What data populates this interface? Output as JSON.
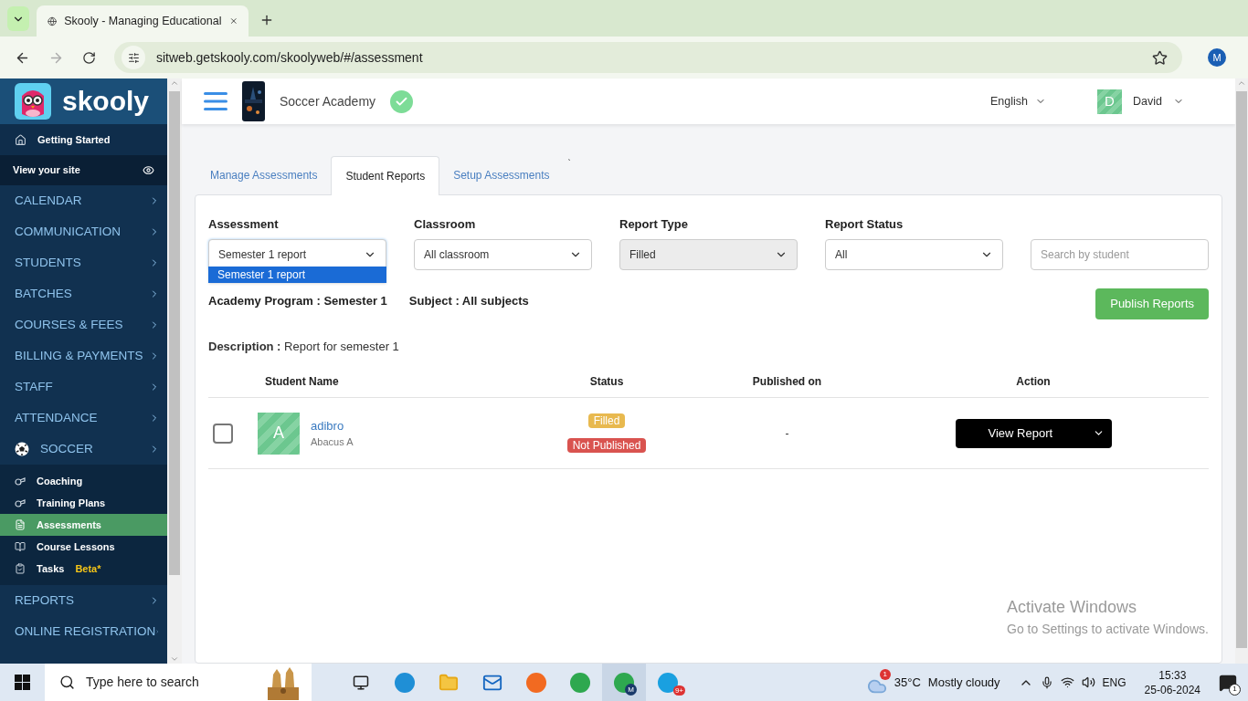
{
  "browser": {
    "tab_title": "Skooly - Managing Educational",
    "url": "sitweb.getskooly.com/skoolyweb/#/assessment",
    "profile_initial": "M"
  },
  "sidebar": {
    "logo_text": "skooly",
    "getting_started": "Getting Started",
    "view_site": "View your site",
    "menu": [
      {
        "label": "CALENDAR",
        "kind": "section"
      },
      {
        "label": "COMMUNICATION",
        "kind": "section"
      },
      {
        "label": "STUDENTS",
        "kind": "section"
      },
      {
        "label": "BATCHES",
        "kind": "section"
      },
      {
        "label": "COURSES & FEES",
        "kind": "section"
      },
      {
        "label": "BILLING & PAYMENTS",
        "kind": "section"
      },
      {
        "label": "STAFF",
        "kind": "section"
      },
      {
        "label": "ATTENDANCE",
        "kind": "section"
      },
      {
        "label": "SOCCER",
        "kind": "soccer",
        "children": [
          {
            "label": "Coaching",
            "kind": "whistle",
            "selected": false
          },
          {
            "label": "Training Plans",
            "kind": "whistle",
            "selected": false
          },
          {
            "label": "Assessments",
            "kind": "doc",
            "selected": true
          },
          {
            "label": "Course Lessons",
            "kind": "book",
            "selected": false
          },
          {
            "label": "Tasks",
            "kind": "clipboard",
            "selected": false,
            "badge": "Beta*"
          }
        ]
      },
      {
        "label": "REPORTS",
        "kind": "section"
      },
      {
        "label": "ONLINE REGISTRATION",
        "kind": "section"
      }
    ]
  },
  "header": {
    "school": "Soccer Academy",
    "language": "English",
    "user": {
      "initial": "D",
      "name": "David"
    }
  },
  "tabs": [
    {
      "label": "Manage Assessments",
      "selected": false
    },
    {
      "label": "Student Reports",
      "selected": true
    },
    {
      "label": "Setup Assessments",
      "selected": false
    }
  ],
  "stray_mark": "`",
  "filters": [
    {
      "label": "Assessment",
      "value": "Semester 1 report",
      "disabled": false,
      "open": true,
      "options": [
        {
          "label": "Semester 1 report",
          "selected": true
        }
      ]
    },
    {
      "label": "Classroom",
      "value": "All classroom",
      "disabled": false,
      "open": false
    },
    {
      "label": "Report Type",
      "value": "Filled",
      "disabled": true,
      "open": false
    },
    {
      "label": "Report Status",
      "value": "All",
      "disabled": false,
      "open": false
    }
  ],
  "search": {
    "placeholder": "Search by student"
  },
  "program": "Academy Program : Semester 1",
  "subject": "Subject : All subjects",
  "publish_button": "Publish Reports",
  "description": "**Description :** Report for semester 1",
  "table": {
    "columns": [
      "Student Name",
      "Status",
      "Published on",
      "Action"
    ],
    "rows": [
      {
        "checked": false,
        "avatar": "A",
        "name": "adibro",
        "class": "Abacus A",
        "statuses": [
          {
            "label": "Filled",
            "color": "#e8b94f"
          },
          {
            "label": "Not Published",
            "color": "#d9534f"
          }
        ],
        "published_on": "-",
        "action": "View Report"
      }
    ]
  },
  "activation": {
    "title": "Activate Windows",
    "subtitle": "Go to Settings to activate Windows."
  },
  "taskbar": {
    "search_placeholder": "Type here to search",
    "chrome_badge": "M",
    "skype_badge": "9+",
    "weather_badge": "1",
    "temperature": "35°C",
    "weather": "Mostly cloudy",
    "language": "ENG",
    "time": "15:33",
    "date": "25-06-2024",
    "notifications": "1"
  }
}
